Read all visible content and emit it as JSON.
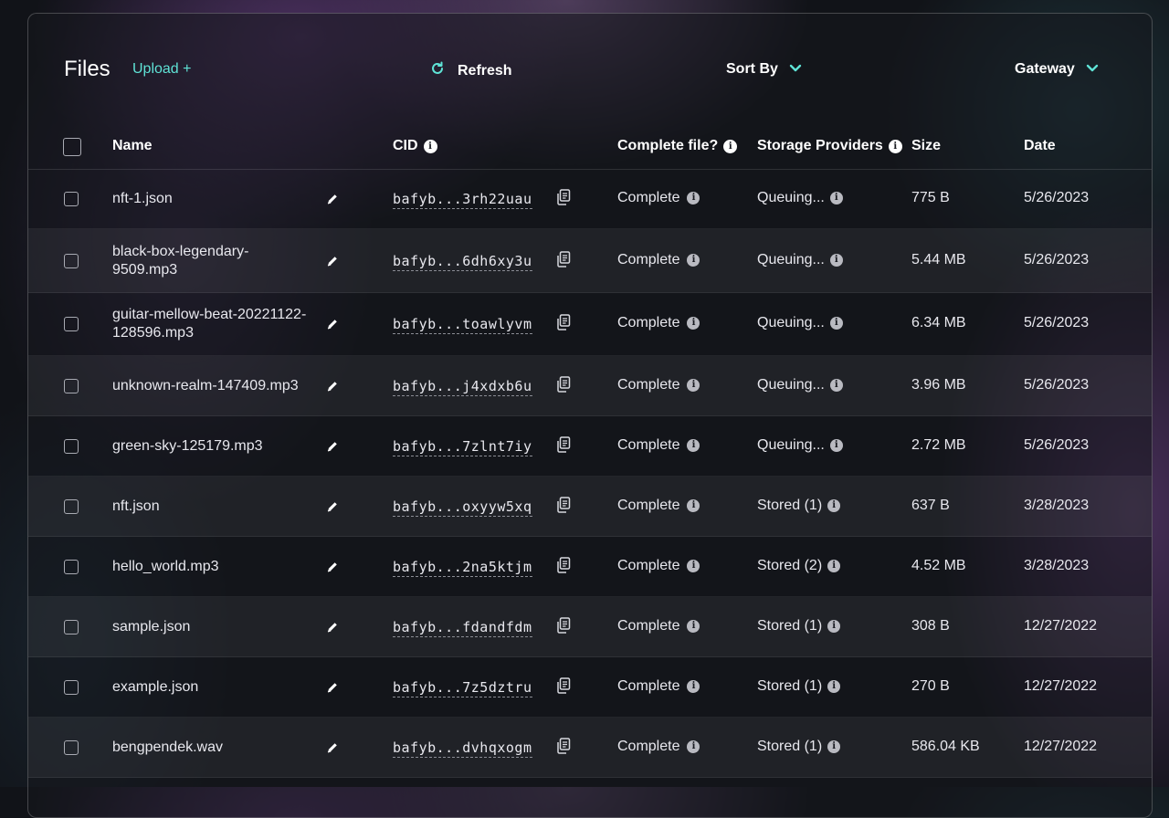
{
  "toolbar": {
    "title": "Files",
    "upload_label": "Upload +",
    "refresh_label": "Refresh",
    "sort_label": "Sort By",
    "gateway_label": "Gateway"
  },
  "columns": {
    "name": "Name",
    "cid": "CID",
    "complete": "Complete file?",
    "storage": "Storage Providers",
    "size": "Size",
    "date": "Date"
  },
  "colors": {
    "accent": "#5fe3d6",
    "background": "#111318"
  },
  "rows": [
    {
      "name": "nft-1.json",
      "cid": "bafyb...3rh22uau",
      "complete": "Complete",
      "storage": "Queuing...",
      "size": "775 B",
      "date": "5/26/2023"
    },
    {
      "name": "black-box-legendary-9509.mp3",
      "cid": "bafyb...6dh6xy3u",
      "complete": "Complete",
      "storage": "Queuing...",
      "size": "5.44 MB",
      "date": "5/26/2023"
    },
    {
      "name": "guitar-mellow-beat-20221122-128596.mp3",
      "cid": "bafyb...toawlyvm",
      "complete": "Complete",
      "storage": "Queuing...",
      "size": "6.34 MB",
      "date": "5/26/2023"
    },
    {
      "name": "unknown-realm-147409.mp3",
      "cid": "bafyb...j4xdxb6u",
      "complete": "Complete",
      "storage": "Queuing...",
      "size": "3.96 MB",
      "date": "5/26/2023"
    },
    {
      "name": "green-sky-125179.mp3",
      "cid": "bafyb...7zlnt7iy",
      "complete": "Complete",
      "storage": "Queuing...",
      "size": "2.72 MB",
      "date": "5/26/2023"
    },
    {
      "name": "nft.json",
      "cid": "bafyb...oxyyw5xq",
      "complete": "Complete",
      "storage": "Stored (1)",
      "size": "637 B",
      "date": "3/28/2023"
    },
    {
      "name": "hello_world.mp3",
      "cid": "bafyb...2na5ktjm",
      "complete": "Complete",
      "storage": "Stored (2)",
      "size": "4.52 MB",
      "date": "3/28/2023"
    },
    {
      "name": "sample.json",
      "cid": "bafyb...fdandfdm",
      "complete": "Complete",
      "storage": "Stored (1)",
      "size": "308 B",
      "date": "12/27/2022"
    },
    {
      "name": "example.json",
      "cid": "bafyb...7z5dztru",
      "complete": "Complete",
      "storage": "Stored (1)",
      "size": "270 B",
      "date": "12/27/2022"
    },
    {
      "name": "bengpendek.wav",
      "cid": "bafyb...dvhqxogm",
      "complete": "Complete",
      "storage": "Stored (1)",
      "size": "586.04 KB",
      "date": "12/27/2022"
    }
  ]
}
